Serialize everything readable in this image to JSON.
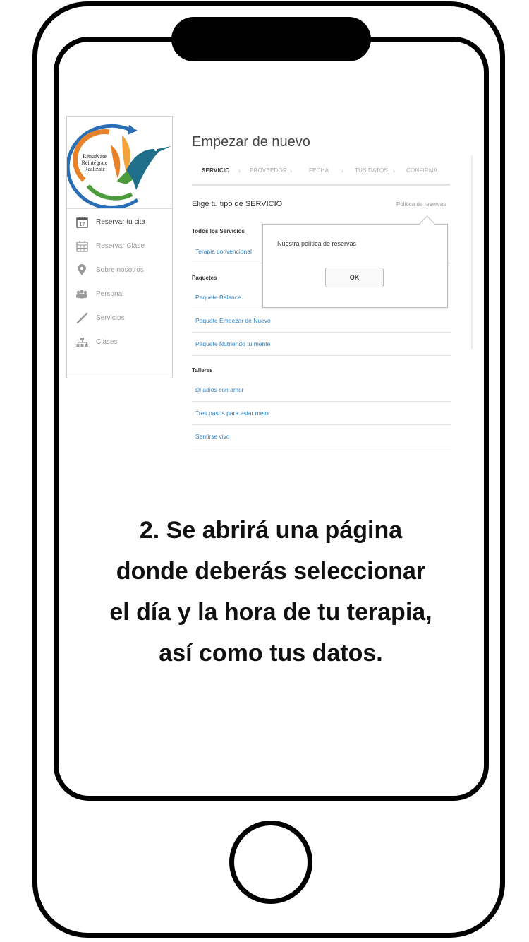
{
  "sidebar": {
    "logo": {
      "lines": [
        "Renuévate",
        "Reintégrate",
        "Realízate"
      ]
    },
    "items": [
      {
        "label": "Reservar tu cita",
        "icon": "calendar-icon",
        "day": "17"
      },
      {
        "label": "Reservar Clase",
        "icon": "calendar-grid-icon"
      },
      {
        "label": "Sobre nosotros",
        "icon": "location-pin-icon"
      },
      {
        "label": "Personal",
        "icon": "people-icon"
      },
      {
        "label": "Servicios",
        "icon": "pencil-icon"
      },
      {
        "label": "Clases",
        "icon": "org-chart-icon"
      }
    ]
  },
  "main": {
    "title": "Empezar de nuevo",
    "steps": [
      "SERVICIO",
      "PROVEEDOR",
      "FECHA",
      "TUS DATOS",
      "CONFIRMA"
    ],
    "section_title": "Elige tu tipo de SERVICIO",
    "policy_link": "Política de reservas",
    "categories": [
      {
        "label": "Todos los Servicios",
        "services": [
          "Terapia convencional"
        ]
      },
      {
        "label": "Paquetes",
        "services": [
          "Paquete Balance",
          "Paquete Empezar de Nuevo",
          "Paquete Nutriendo tu mente"
        ]
      },
      {
        "label": "Talleres",
        "services": [
          "Di adiós con amor",
          "Tres pasos para estar mejor",
          "Sentirse vivo"
        ]
      }
    ]
  },
  "popup": {
    "text": "Nuestra política de reservas",
    "ok_label": "OK"
  },
  "caption": "2. Se abrirá una página donde deberás seleccionar el día y la hora de tu terapia, así como tus datos.",
  "colors": {
    "link": "#2f7fc0",
    "logo_orange": "#e8822a",
    "logo_blue": "#2a6fb5",
    "logo_green": "#4b9a3c",
    "bird": "#1f6f8b"
  }
}
